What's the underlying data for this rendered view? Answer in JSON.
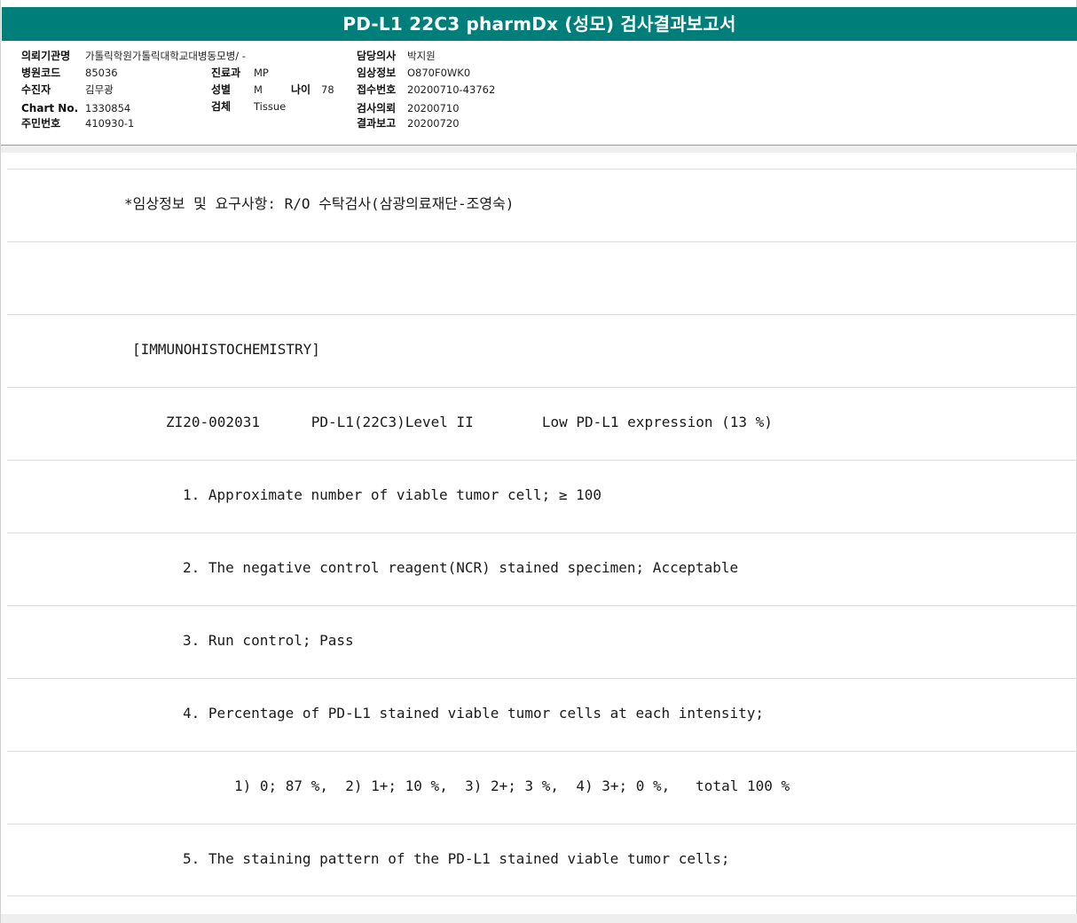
{
  "report": {
    "title": "PD-L1 22C3 pharmDx (성모) 검사결과보고서"
  },
  "patient": {
    "institution_label": "의뢰기관명",
    "institution_value": "가톨릭학원가톨릭대학교대병동모병/ -",
    "hospital_code_label": "병원코드",
    "hospital_code_value": "85036",
    "dept_label": "진료과",
    "dept_value": "MP",
    "patient_label": "수진자",
    "patient_value": "김무광",
    "sex_label": "성별",
    "sex_value": "M",
    "age_label": "나이",
    "age_value": "78",
    "chart_label": "Chart No.",
    "chart_value": "1330854",
    "specimen_label": "검체",
    "specimen_value": "Tissue",
    "rrn_label": "주민번호",
    "rrn_value": "410930-1",
    "doctor_label": "담당의사",
    "doctor_value": "박지원",
    "clinical_label": "임상정보",
    "clinical_value": "O870F0WK0",
    "receipt_label": "접수번호",
    "receipt_value": "20200710-43762",
    "request_label": "검사의뢰",
    "request_value": "20200710",
    "result_label": "결과보고",
    "result_value": "20200720"
  },
  "body": {
    "lines": [
      "*임상정보 및 요구사항: R/O 수탁검사(삼광의료재단-조영숙)",
      "",
      "[IMMUNOHISTOCHEMISTRY]",
      "ZI20-002031      PD-L1(22C3)Level II        Low PD-L1 expression (13 %)",
      "1. Approximate number of viable tumor cell; ≥ 100",
      "2. The negative control reagent(NCR) stained specimen; Acceptable",
      "3. Run control; Pass",
      "4. Percentage of PD-L1 stained viable tumor cells at each intensity;",
      "1) 0; 87 %,  2) 1+; 10 %,  3) 2+; 3 %,  4) 3+; 0 %,   total 100 %",
      "5. The staining pattern of the PD-L1 stained viable tumor cells;"
    ]
  },
  "colors": {
    "title_bg": "#007f7a"
  }
}
